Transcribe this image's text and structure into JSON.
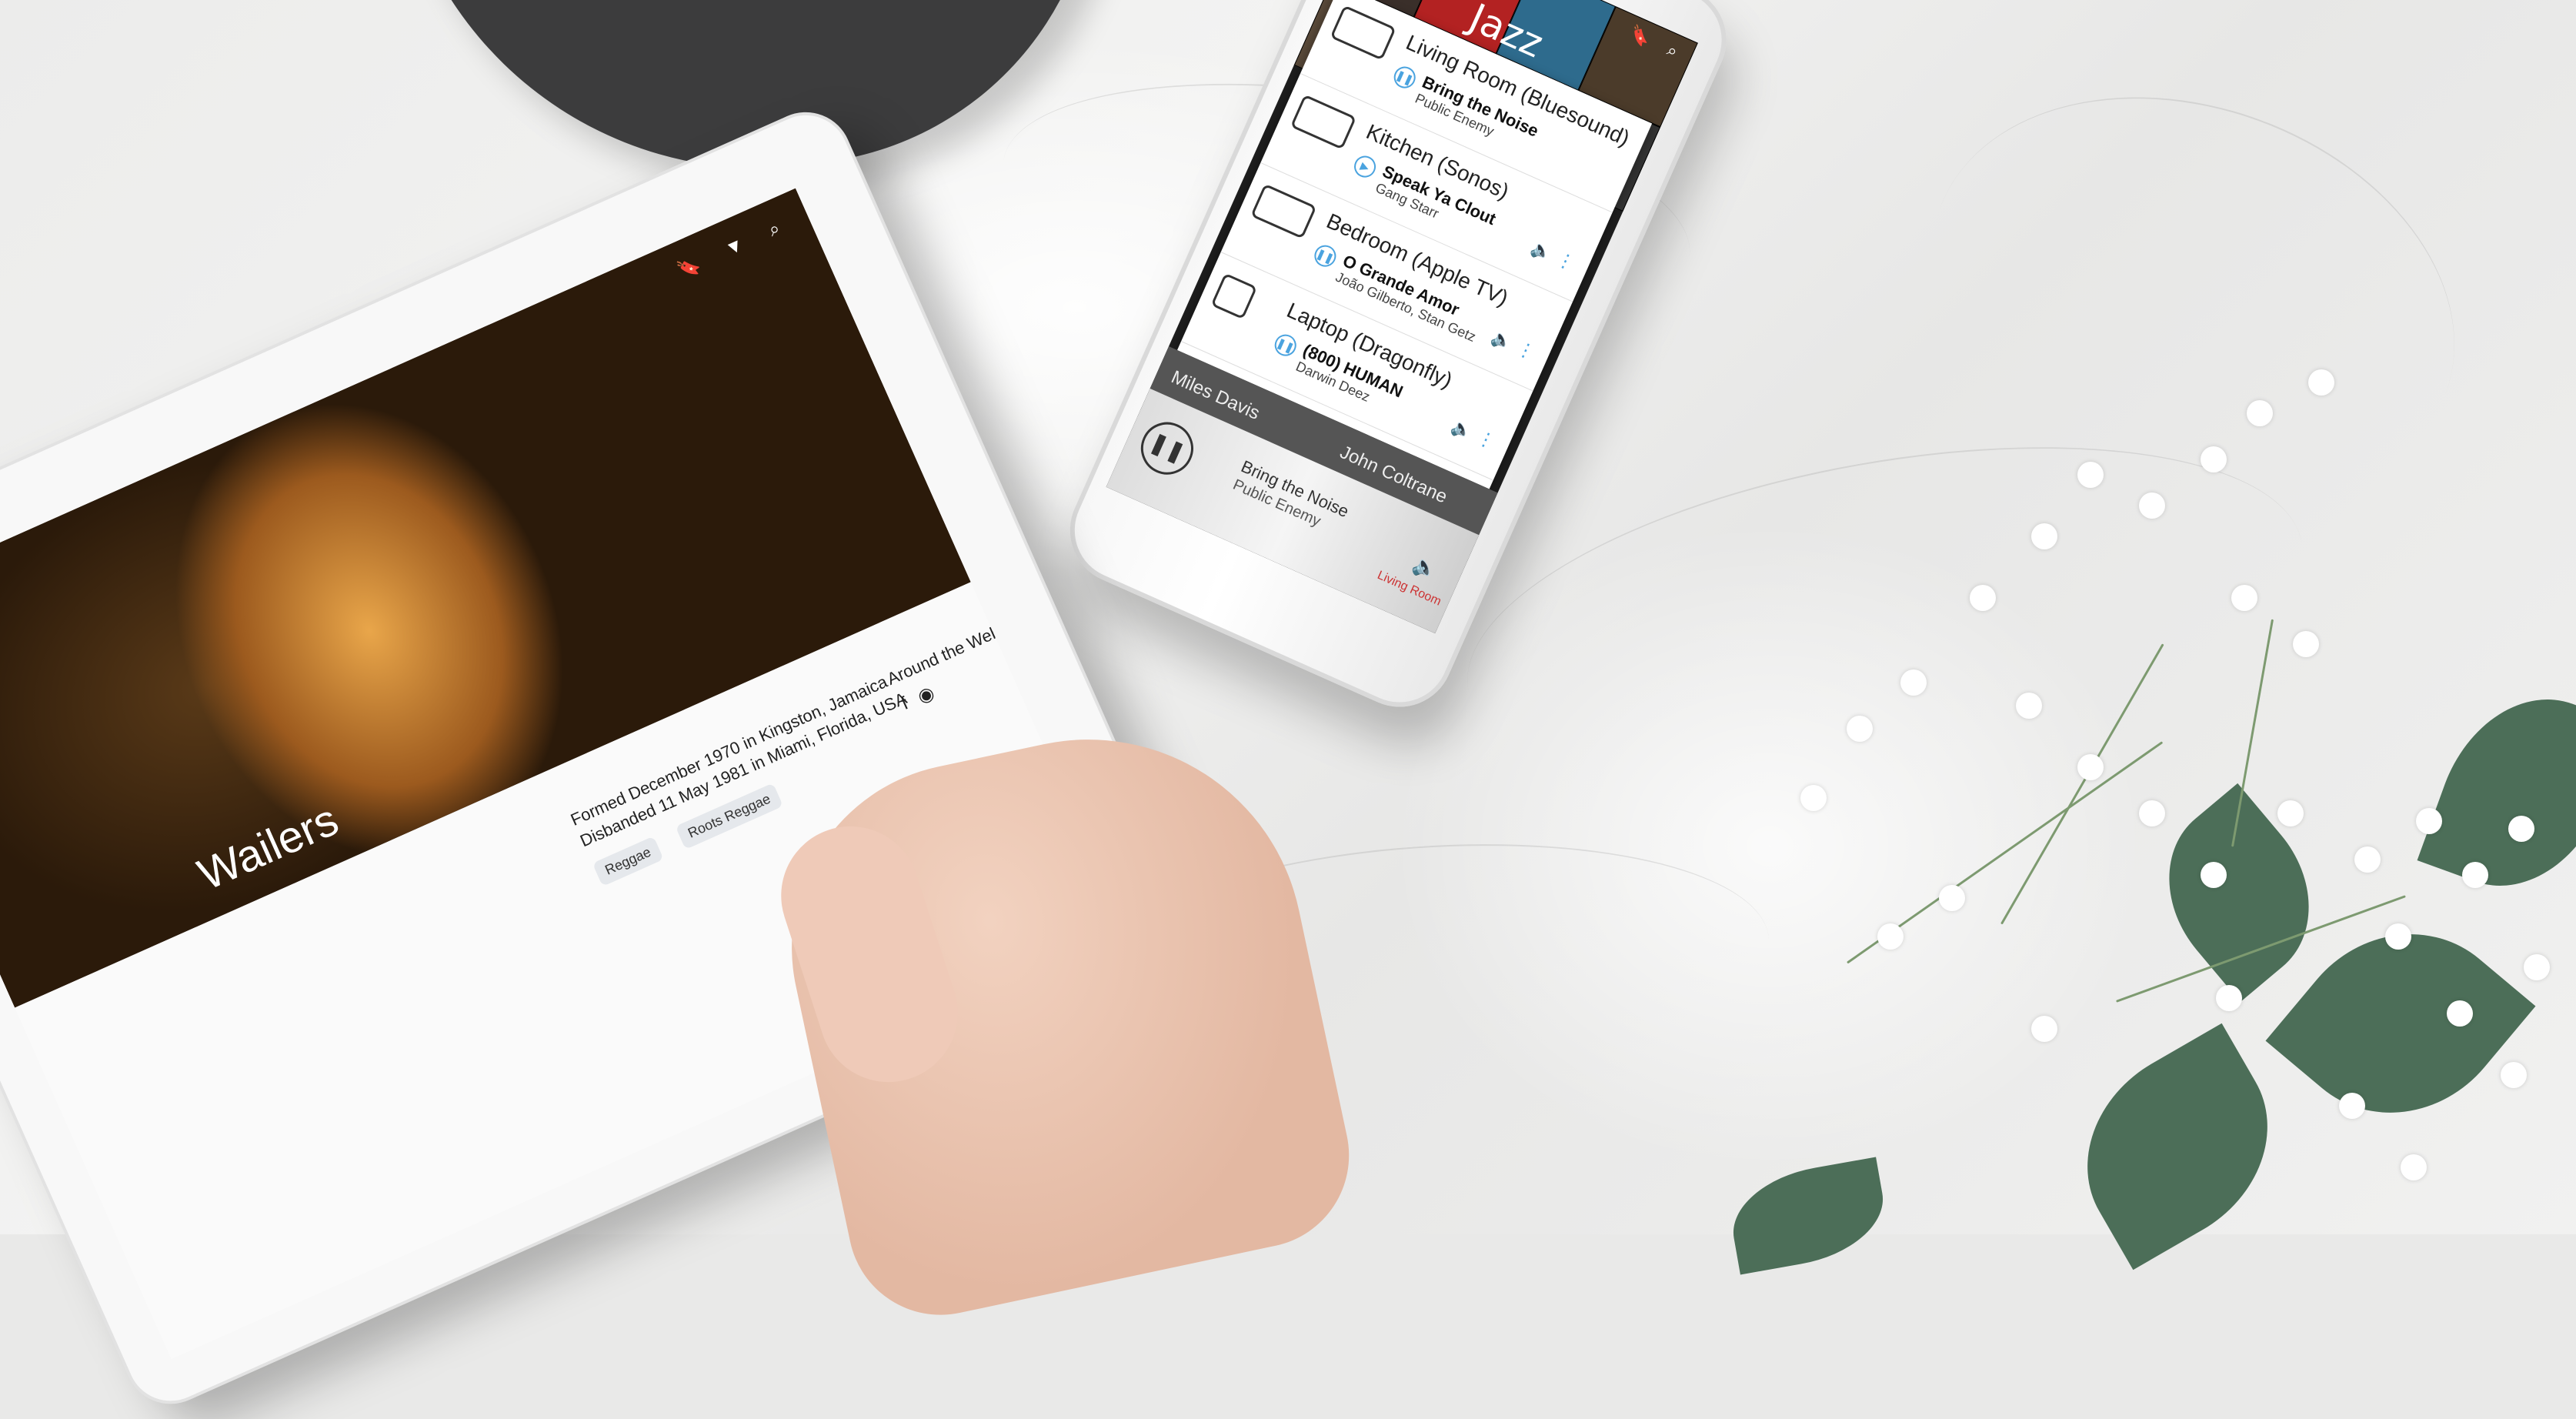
{
  "phone": {
    "genre_title": "Jazz",
    "zones": [
      {
        "name": "Living Room (Bluesound)",
        "track": "Bring the Noise",
        "artist": "Public Enemy",
        "state": "pause"
      },
      {
        "name": "Kitchen (Sonos)",
        "track": "Speak Ya Clout",
        "artist": "Gang Starr",
        "state": "play"
      },
      {
        "name": "Bedroom (Apple TV)",
        "track": "O Grande Amor",
        "artist": "João Gilberto, Stan Getz",
        "state": "pause"
      },
      {
        "name": "Laptop (Dragonfly)",
        "track": "(800) HUMAN",
        "artist": "Darwin Deez",
        "state": "pause"
      }
    ],
    "grid_labels": [
      "Miles Davis",
      "John Coltrane"
    ],
    "now_playing": {
      "track": "Bring the Noise",
      "artist": "Public Enemy",
      "room": "Living Room"
    }
  },
  "tablet": {
    "band_name": "Wailers",
    "formed": "Formed December 1970 in Kingston, Jamaica",
    "disbanded": "Disbanded 11 May 1981 in Miami, Florida, USA",
    "tags": [
      "Reggae",
      "Roots Reggae"
    ],
    "around_label": "Around the Web"
  },
  "icons": {
    "bookmark": "🔖",
    "filter": "▼",
    "search": "⌕",
    "pause": "❚❚",
    "play": "▶",
    "volume": "🔈",
    "more": "⋮",
    "facebook": "f",
    "web": "◉"
  }
}
